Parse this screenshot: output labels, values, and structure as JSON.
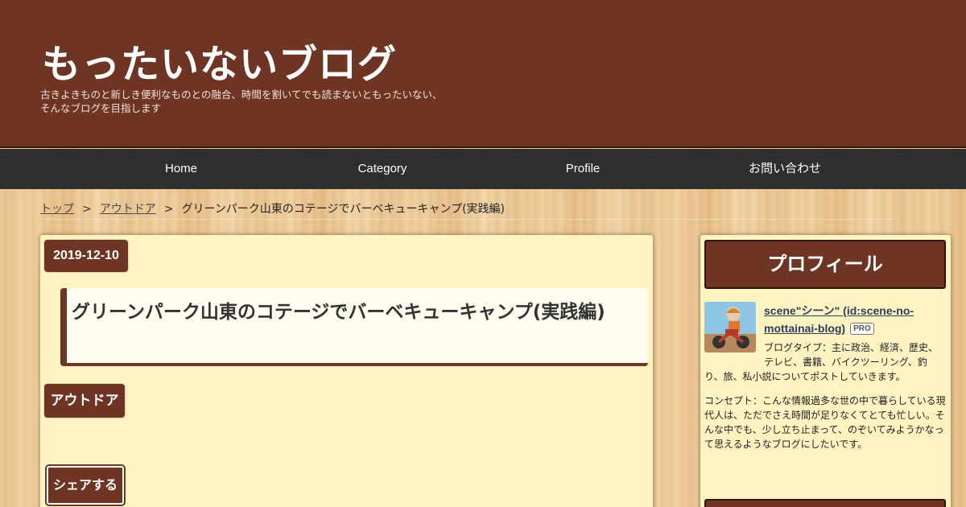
{
  "header": {
    "title": "もったいないブログ",
    "description": "古きよきものと新しき便利なものとの融合、時間を割いてでも読まないともったいない、そんなブログを目指します"
  },
  "nav": {
    "items": [
      {
        "label": "Home"
      },
      {
        "label": "Category"
      },
      {
        "label": "Profile"
      },
      {
        "label": "お問い合わせ"
      }
    ]
  },
  "breadcrumb": {
    "top": "トップ",
    "separator": ">",
    "category": "アウトドア",
    "current": "グリーンパーク山東のコテージでバーベキューキャンプ(実践編)"
  },
  "article": {
    "date": "2019-12-10",
    "title": "グリーンパーク山東のコテージでバーベキューキャンプ(実践編)",
    "category": "アウトドア",
    "share_label": "シェアする"
  },
  "sidebar": {
    "profile_title": "プロフィール",
    "name": "scene\"シーン\" (id:scene-no-mottainai-blog)",
    "pro_badge": "PRO",
    "blog_type": "ブログタイプ：主に政治、経済、歴史、テレビ、書籍、バイクツーリング、釣り、旅、私小説についてポストしていきます。",
    "concept": "コンセプト：こんな情報過多な世の中で暮らしている現代人は、ただでさえ時間が足りなくてとても忙しい。そんな中でも、少し立ち止まって、のぞいてみようかなって思えるようなブログにしたいです。"
  },
  "colors": {
    "brand": "#6e3424",
    "nav_bg": "#2f2f2f",
    "card_bg": "#fff3c2"
  }
}
